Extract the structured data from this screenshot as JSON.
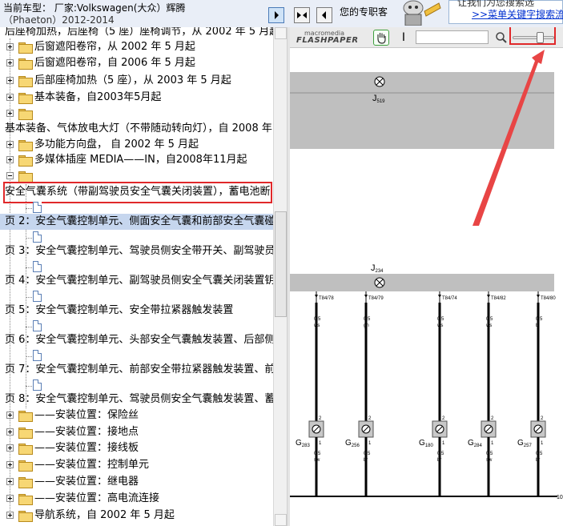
{
  "header": {
    "car_model": "当前车型： 厂家:Volkswagen(大众）辉腾",
    "car_model_sub": "（Phaeton）2012-2014",
    "ad_label": "您的专职客",
    "ad_line1": "让我们为您搜索选",
    "ad_link": ">>菜单关键字搜索流"
  },
  "tree": {
    "items": [
      {
        "kind": "text",
        "label": "后座椅加热，后座椅（5 座）座椅调节，从 2002 年 5 月起"
      },
      {
        "kind": "folder",
        "label": "后窗遮阳卷帘，从 2002 年 5 月起"
      },
      {
        "kind": "folder",
        "label": "后窗遮阳卷帘，自 2006 年 5 月起"
      },
      {
        "kind": "folder",
        "label": "后部座椅加热（5 座），从 2003 年 5 月起"
      },
      {
        "kind": "folder",
        "label": "基本装备，自2003年5月起"
      },
      {
        "kind": "folder",
        "label": ""
      },
      {
        "kind": "text",
        "label": "基本装备、气体放电大灯（不带随动转向灯），自 2008 年"
      },
      {
        "kind": "folder",
        "label": "多功能方向盘， 自 2002 年 5 月起"
      },
      {
        "kind": "folder",
        "label": "多媒体插座 MEDIA——IN，自2008年11月起"
      },
      {
        "kind": "folder",
        "label": ""
      },
      {
        "kind": "text",
        "label": "安全气囊系统（带副驾驶员安全气囊关闭装置），蓄电池断"
      },
      {
        "kind": "doc",
        "label": ""
      },
      {
        "kind": "page",
        "label": "页 2：安全气囊控制单元、侧面安全气囊和前部安全气囊碰"
      },
      {
        "kind": "doc",
        "label": ""
      },
      {
        "kind": "page",
        "label": "页 3：安全气囊控制单元、驾驶员侧安全带开关、副驾驶员"
      },
      {
        "kind": "doc",
        "label": ""
      },
      {
        "kind": "page",
        "label": "页 4：安全气囊控制单元、副驾驶员侧安全气囊关闭装置钥"
      },
      {
        "kind": "doc",
        "label": ""
      },
      {
        "kind": "page",
        "label": "页 5：安全气囊控制单元、安全带拉紧器触发装置"
      },
      {
        "kind": "doc",
        "label": ""
      },
      {
        "kind": "page",
        "label": "页 6：安全气囊控制单元、头部安全气囊触发装置、后部侧"
      },
      {
        "kind": "doc",
        "label": ""
      },
      {
        "kind": "page",
        "label": "页 7：安全气囊控制单元、前部安全带拉紧器触发装置、前"
      },
      {
        "kind": "doc",
        "label": ""
      },
      {
        "kind": "page",
        "label": "页 8：安全气囊控制单元、驾驶员侧安全气囊触发装置、蓄"
      },
      {
        "kind": "sub",
        "label": "——安装位置：保险丝"
      },
      {
        "kind": "sub",
        "label": "——安装位置：接地点"
      },
      {
        "kind": "sub",
        "label": "——安装位置：接线板"
      },
      {
        "kind": "sub",
        "label": "——安装位置：控制单元"
      },
      {
        "kind": "sub",
        "label": "——安装位置：继电器"
      },
      {
        "kind": "sub",
        "label": "——安装位置：高电流连接"
      },
      {
        "kind": "folder",
        "label": "导航系统，自 2002 年 5 月起"
      }
    ]
  },
  "viewer": {
    "logo_line1": "macromedia",
    "logo_line2": "FLASHPAPER",
    "search_placeholder": "",
    "text_tool": "I",
    "zoom_fraction": 0.7
  },
  "diagram": {
    "top_component": "J",
    "top_component_sub": "519",
    "mid_component": "J",
    "mid_component_sub": "234",
    "connectors": [
      {
        "pin": "T84/78",
        "size": "0,5",
        "color": "ws",
        "part": "G",
        "part_sub": "283",
        "bottom_size": "0,5",
        "bottom_color": "sw"
      },
      {
        "pin": "T84/79",
        "size": "0,5",
        "color": "gn",
        "part": "G",
        "part_sub": "256",
        "bottom_size": "0,5",
        "bottom_color": "br"
      },
      {
        "pin": "T84/74",
        "size": "0,5",
        "color": "ws",
        "part": "G",
        "part_sub": "180",
        "bottom_size": "0,5",
        "bottom_color": "br"
      },
      {
        "pin": "T84/82",
        "size": "0,5",
        "color": "ws",
        "part": "G",
        "part_sub": "284",
        "bottom_size": "0,5",
        "bottom_color": "sw"
      },
      {
        "pin": "T84/80",
        "size": "0,5",
        "color": "bl",
        "part": "G",
        "part_sub": "257",
        "bottom_size": "0,5",
        "bottom_color": "br"
      }
    ],
    "pin_top": "2",
    "pin_bottom": "1",
    "ground_label": "10"
  }
}
